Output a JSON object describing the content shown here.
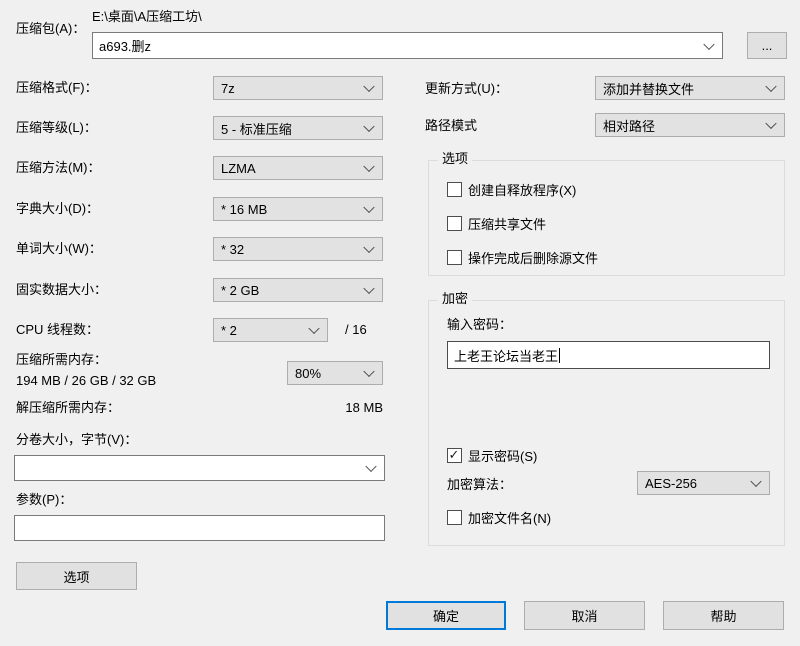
{
  "colors": {
    "window_bg": "#f0f0f0",
    "control_bg": "#e2e2e2",
    "control_border": "#adadad",
    "accent_blue": "#0078d7"
  },
  "archive": {
    "label": "压缩包(A)：",
    "dir_path": "E:\\桌面\\A压缩工坊\\",
    "filename": "a693.删z",
    "browse_label": "..."
  },
  "fields": {
    "format": {
      "label": "压缩格式(F)：",
      "value": "7z"
    },
    "level": {
      "label": "压缩等级(L)：",
      "value": "5 - 标准压缩"
    },
    "method": {
      "label": "压缩方法(M)：",
      "value": "LZMA"
    },
    "dict": {
      "label": "字典大小(D)：",
      "value": "* 16 MB"
    },
    "word": {
      "label": "单词大小(W)：",
      "value": "* 32"
    },
    "solid": {
      "label": "固实数据大小：",
      "value": "* 2 GB"
    },
    "threads": {
      "label": "CPU 线程数：",
      "value": "* 2",
      "suffix": "/ 16"
    },
    "mem_compress": {
      "label": "压缩所需内存：",
      "detail": "194 MB / 26 GB / 32 GB",
      "value": "80%"
    },
    "mem_decompress": {
      "label": "解压缩所需内存：",
      "value": "18 MB"
    },
    "volume": {
      "label": "分卷大小，字节(V)：",
      "value": ""
    },
    "params": {
      "label": "参数(P)：",
      "value": ""
    }
  },
  "options_button_label": "选项",
  "right": {
    "update_mode": {
      "label": "更新方式(U)：",
      "value": "添加并替换文件"
    },
    "path_mode": {
      "label": "路径模式",
      "value": "相对路径"
    },
    "options_group": {
      "title": "选项",
      "sfx": {
        "label": "创建自释放程序(X)",
        "checked": false
      },
      "shared": {
        "label": "压缩共享文件",
        "checked": false
      },
      "delete": {
        "label": "操作完成后删除源文件",
        "checked": false
      }
    },
    "encryption_group": {
      "title": "加密",
      "password_label": "输入密码：",
      "password_value": "上老王论坛当老王",
      "show_password": {
        "label": "显示密码(S)",
        "checked": true
      },
      "algorithm": {
        "label": "加密算法：",
        "value": "AES-256"
      },
      "encrypt_names": {
        "label": "加密文件名(N)",
        "checked": false
      }
    }
  },
  "footer": {
    "ok": "确定",
    "cancel": "取消",
    "help": "帮助"
  }
}
